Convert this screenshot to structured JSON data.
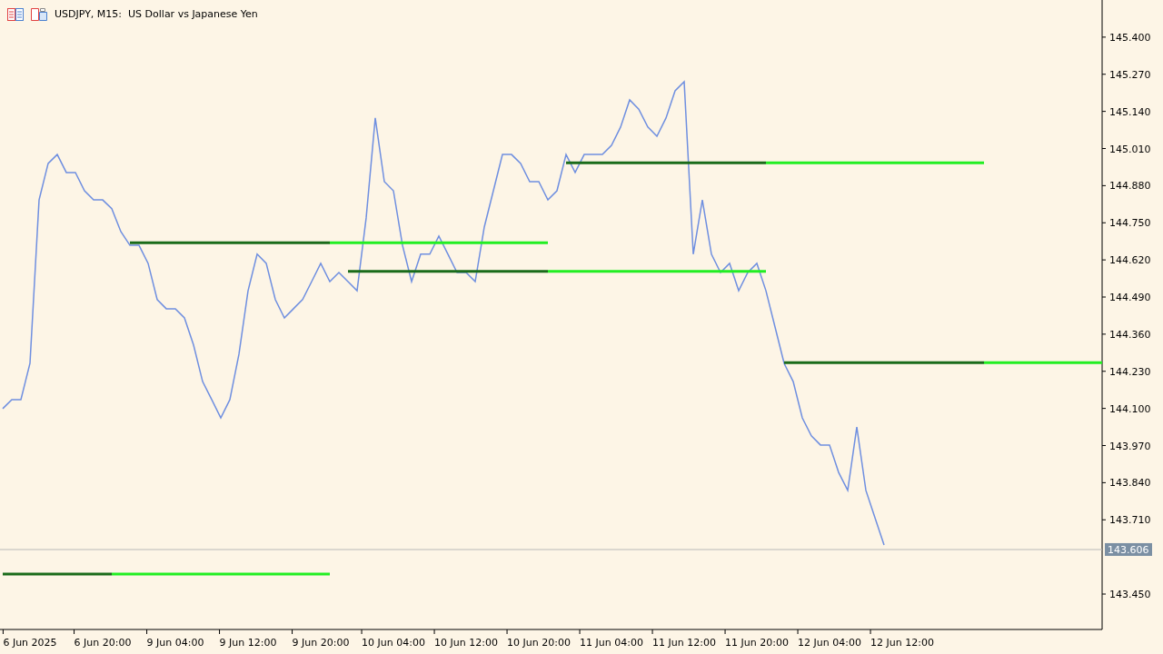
{
  "header": {
    "title": "USDJPY, M15:  US Dollar vs Japanese Yen"
  },
  "chart": {
    "chart_data": {
      "type": "line",
      "ylim": [
        143.326,
        145.53
      ],
      "categories": [
        null,
        null,
        null,
        "6 Jun 2025",
        null,
        null,
        null,
        null,
        null,
        null,
        null,
        "6 Jun 20:00",
        null,
        null,
        null,
        null,
        null,
        null,
        null,
        "9 Jun 04:00",
        null,
        null,
        null,
        null,
        null,
        null,
        null,
        "9 Jun 12:00",
        null,
        null,
        null,
        null,
        null,
        null,
        null,
        "9 Jun 20:00",
        null,
        null,
        null,
        null,
        null,
        null,
        null,
        "10 Jun 04:00",
        null,
        null,
        null,
        null,
        null,
        null,
        null,
        "10 Jun 12:00",
        null,
        null,
        null,
        null,
        null,
        null,
        null,
        "10 Jun 20:00",
        null,
        null,
        null,
        null,
        null,
        null,
        null,
        "11 Jun 04:00",
        null,
        null,
        null,
        null,
        null,
        null,
        null,
        "11 Jun 12:00",
        null,
        null,
        null,
        null,
        null,
        null,
        null,
        "11 Jun 20:00",
        null,
        null,
        null,
        null,
        null,
        null,
        null,
        "12 Jun 04:00",
        null,
        null,
        null,
        null,
        null,
        null,
        null,
        "12 Jun 12:00",
        null,
        null,
        null,
        null,
        null,
        null,
        null,
        null,
        null,
        null,
        null,
        null,
        null,
        null,
        null,
        null,
        null,
        null,
        null,
        null,
        null,
        null
      ],
      "series": [
        {
          "color": "#6f8fe0",
          "values": [
            144.099,
            144.131,
            144.131,
            144.258,
            144.83,
            144.958,
            144.989,
            144.926,
            144.926,
            144.862,
            144.83,
            144.83,
            144.799,
            144.719,
            144.671,
            144.671,
            144.608,
            144.481,
            144.449,
            144.449,
            144.417,
            144.322,
            144.194,
            144.131,
            144.067,
            144.131,
            144.29,
            144.512,
            144.64,
            144.608,
            144.481,
            144.417,
            144.449,
            144.481,
            144.544,
            144.608,
            144.544,
            144.576,
            144.544,
            144.512,
            144.767,
            145.117,
            144.894,
            144.862,
            144.671,
            144.544,
            144.64,
            144.64,
            144.703,
            144.64,
            144.576,
            144.576,
            144.544,
            144.735,
            144.862,
            144.989,
            144.989,
            144.958,
            144.894,
            144.894,
            144.83,
            144.862,
            144.989,
            144.926,
            144.989,
            144.989,
            144.989,
            145.021,
            145.085,
            145.18,
            145.148,
            145.085,
            145.053,
            145.117,
            145.212,
            145.244,
            144.64,
            144.83,
            144.64,
            144.576,
            144.608,
            144.512,
            144.576,
            144.608,
            144.512,
            144.385,
            144.258,
            144.194,
            144.067,
            144.004,
            143.972,
            143.972,
            143.876,
            143.813,
            144.035,
            143.813,
            143.717,
            143.622,
            null,
            null,
            null,
            null,
            null,
            null,
            null,
            null,
            null,
            null,
            null,
            null,
            null,
            null,
            null,
            null,
            null,
            null,
            null,
            null,
            null,
            null,
            null,
            null
          ]
        },
        {
          "color": "#1a6b1a",
          "values": [
            143.52,
            143.52,
            143.52,
            143.52,
            143.52,
            143.52,
            143.52,
            143.52,
            143.52,
            143.52,
            143.52,
            143.52,
            143.52,
            null,
            144.68,
            144.68,
            144.68,
            144.68,
            144.68,
            144.68,
            144.68,
            144.68,
            144.68,
            144.68,
            144.68,
            144.68,
            144.68,
            144.68,
            144.68,
            144.68,
            144.68,
            144.68,
            144.68,
            144.68,
            144.68,
            144.68,
            144.68,
            null,
            144.58,
            144.58,
            144.58,
            144.58,
            144.58,
            144.58,
            144.58,
            144.58,
            144.58,
            144.58,
            144.58,
            144.58,
            144.58,
            144.58,
            144.58,
            144.58,
            144.58,
            144.58,
            144.58,
            144.58,
            144.58,
            144.58,
            144.58,
            null,
            144.96,
            144.96,
            144.96,
            144.96,
            144.96,
            144.96,
            144.96,
            144.96,
            144.96,
            144.96,
            144.96,
            144.96,
            144.96,
            144.96,
            144.96,
            144.96,
            144.96,
            144.96,
            144.96,
            144.96,
            144.96,
            144.96,
            144.96,
            null,
            144.26,
            144.26,
            144.26,
            144.26,
            144.26,
            144.26,
            144.26,
            144.26,
            144.26,
            144.26,
            144.26,
            144.26,
            144.26,
            144.26,
            144.26,
            144.26,
            144.26,
            144.26,
            144.26,
            144.26,
            144.26,
            144.26,
            144.26,
            null,
            null,
            null,
            null,
            null,
            null,
            null,
            null,
            null,
            null,
            null,
            null,
            null
          ]
        },
        {
          "color": "#22ee22",
          "values": [
            null,
            null,
            null,
            null,
            null,
            null,
            null,
            null,
            null,
            null,
            null,
            null,
            143.52,
            143.52,
            143.52,
            143.52,
            143.52,
            143.52,
            143.52,
            143.52,
            143.52,
            143.52,
            143.52,
            143.52,
            143.52,
            143.52,
            143.52,
            143.52,
            143.52,
            143.52,
            143.52,
            143.52,
            143.52,
            143.52,
            143.52,
            143.52,
            143.52,
            null,
            null,
            null,
            null,
            null,
            null,
            null,
            null,
            null,
            null,
            null,
            null,
            null,
            null,
            null,
            null,
            null,
            null,
            null,
            null,
            null,
            null,
            null,
            144.58,
            144.58,
            144.58,
            144.58,
            144.58,
            144.58,
            144.58,
            144.58,
            144.58,
            144.58,
            144.58,
            144.58,
            144.58,
            144.58,
            144.58,
            144.58,
            144.58,
            144.58,
            144.58,
            144.58,
            144.58,
            144.58,
            144.58,
            144.58,
            144.58,
            null,
            null,
            null,
            null,
            null,
            null,
            null,
            null,
            null,
            null,
            null,
            null,
            null,
            null,
            null,
            null,
            null,
            null,
            null,
            null,
            null,
            null,
            null,
            144.26,
            144.26,
            144.26,
            144.26,
            144.26,
            144.26,
            144.26,
            144.26,
            144.26,
            144.26,
            144.26,
            144.26,
            144.26,
            144.26
          ]
        },
        {
          "color": "#22ee22",
          "values": [
            null,
            null,
            null,
            null,
            null,
            null,
            null,
            null,
            null,
            null,
            null,
            null,
            null,
            null,
            null,
            null,
            null,
            null,
            null,
            null,
            null,
            null,
            null,
            null,
            null,
            null,
            null,
            null,
            null,
            null,
            null,
            null,
            null,
            null,
            null,
            null,
            144.68,
            144.68,
            144.68,
            144.68,
            144.68,
            144.68,
            144.68,
            144.68,
            144.68,
            144.68,
            144.68,
            144.68,
            144.68,
            144.68,
            144.68,
            144.68,
            144.68,
            144.68,
            144.68,
            144.68,
            144.68,
            144.68,
            144.68,
            144.68,
            144.68,
            null,
            null,
            null,
            null,
            null,
            null,
            null,
            null,
            null,
            null,
            null,
            null,
            null,
            null,
            null,
            null,
            null,
            null,
            null,
            null,
            null,
            null,
            null,
            144.96,
            144.96,
            144.96,
            144.96,
            144.96,
            144.96,
            144.96,
            144.96,
            144.96,
            144.96,
            144.96,
            144.96,
            144.96,
            144.96,
            144.96,
            144.96,
            144.96,
            144.96,
            144.96,
            144.96,
            144.96,
            144.96,
            144.96,
            144.96,
            144.96,
            null,
            null,
            null,
            null,
            null,
            null,
            null,
            null,
            null,
            null,
            null,
            null,
            null
          ]
        },
        {
          "color": "#b8b8b8",
          "values": [
            143.606,
            143.606,
            143.606,
            143.606,
            143.606,
            143.606,
            143.606,
            143.606,
            143.606,
            143.606,
            143.606,
            143.606,
            143.606,
            143.606,
            143.606,
            143.606,
            143.606,
            143.606,
            143.606,
            143.606,
            143.606,
            143.606,
            143.606,
            143.606,
            143.606,
            143.606,
            143.606,
            143.606,
            143.606,
            143.606,
            143.606,
            143.606,
            143.606,
            143.606,
            143.606,
            143.606,
            143.606,
            143.606,
            143.606,
            143.606,
            143.606,
            143.606,
            143.606,
            143.606,
            143.606,
            143.606,
            143.606,
            143.606,
            143.606,
            143.606,
            143.606,
            143.606,
            143.606,
            143.606,
            143.606,
            143.606,
            143.606,
            143.606,
            143.606,
            143.606,
            143.606,
            143.606,
            143.606,
            143.606,
            143.606,
            143.606,
            143.606,
            143.606,
            143.606,
            143.606,
            143.606,
            143.606,
            143.606,
            143.606,
            143.606,
            143.606,
            143.606,
            143.606,
            143.606,
            143.606,
            143.606,
            143.606,
            143.606,
            143.606,
            143.606,
            143.606,
            143.606,
            143.606,
            143.606,
            143.606,
            143.606,
            143.606,
            143.606,
            143.606,
            143.606,
            143.606,
            143.606,
            143.606,
            143.606,
            143.606,
            143.606,
            143.606,
            143.606,
            143.606,
            143.606,
            143.606,
            143.606,
            143.606,
            143.606,
            143.606,
            143.606,
            143.606,
            143.606,
            143.606,
            143.606,
            143.606,
            143.606,
            143.606,
            143.606,
            143.606,
            143.606,
            143.606
          ]
        }
      ],
      "yticks": [
        {
          "value": 145.4,
          "label": "145.400"
        },
        {
          "value": 145.27,
          "label": "145.270"
        },
        {
          "value": 145.14,
          "label": "145.140"
        },
        {
          "value": 145.01,
          "label": "145.010"
        },
        {
          "value": 144.88,
          "label": "144.880"
        },
        {
          "value": 144.75,
          "label": "144.750"
        },
        {
          "value": 144.62,
          "label": "144.620"
        },
        {
          "value": 144.49,
          "label": "144.490"
        },
        {
          "value": 144.36,
          "label": "144.360"
        },
        {
          "value": 144.23,
          "label": "144.230"
        },
        {
          "value": 144.1,
          "label": "144.100"
        },
        {
          "value": 143.97,
          "label": "143.970"
        },
        {
          "value": 143.84,
          "label": "143.840"
        },
        {
          "value": 143.71,
          "label": "143.710"
        },
        {
          "value": 143.45,
          "label": "143.450"
        }
      ],
      "annotations": [
        "143.606"
      ]
    }
  }
}
